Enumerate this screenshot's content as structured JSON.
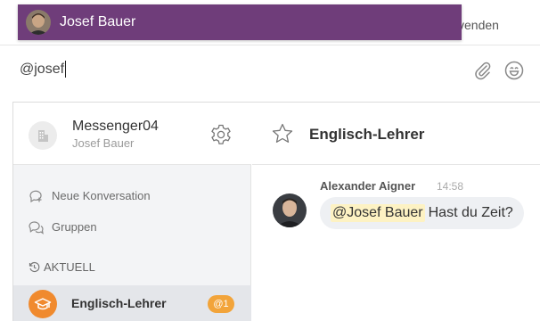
{
  "composer": {
    "send_hint": "venden",
    "input_value": "@josef",
    "attach_icon": "paperclip-icon",
    "emoji_icon": "smiley-icon"
  },
  "mention_popup": {
    "name": "Josef Bauer",
    "background": "#6f3d7a"
  },
  "sidebar": {
    "account_name": "Messenger04",
    "account_user": "Josef Bauer",
    "items": [
      {
        "label": "Neue Konversation",
        "icon": "new-chat-icon"
      },
      {
        "label": "Gruppen",
        "icon": "groups-icon"
      }
    ],
    "current_section": "AKTUELL",
    "active_conversation": {
      "name": "Englisch-Lehrer",
      "badge": "@1",
      "avatar_color": "#f08a2e",
      "badge_color": "#f2a43a"
    }
  },
  "chat": {
    "title": "Englisch-Lehrer",
    "message": {
      "author": "Alexander Aigner",
      "time": "14:58",
      "mention": "@Josef Bauer",
      "text": "Hast du Zeit?"
    }
  }
}
